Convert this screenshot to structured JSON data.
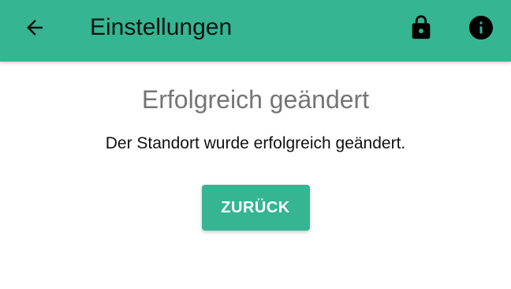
{
  "header": {
    "title": "Einstellungen",
    "background_color": "#35b592",
    "back_icon": "arrow-left-icon",
    "lock_icon": "lock-icon",
    "info_icon": "info-icon"
  },
  "main": {
    "heading": "Erfolgreich geändert",
    "message": "Der Standort wurde erfolgreich geändert.",
    "back_button_label": "ZURÜCK",
    "button_color": "#35b592"
  }
}
